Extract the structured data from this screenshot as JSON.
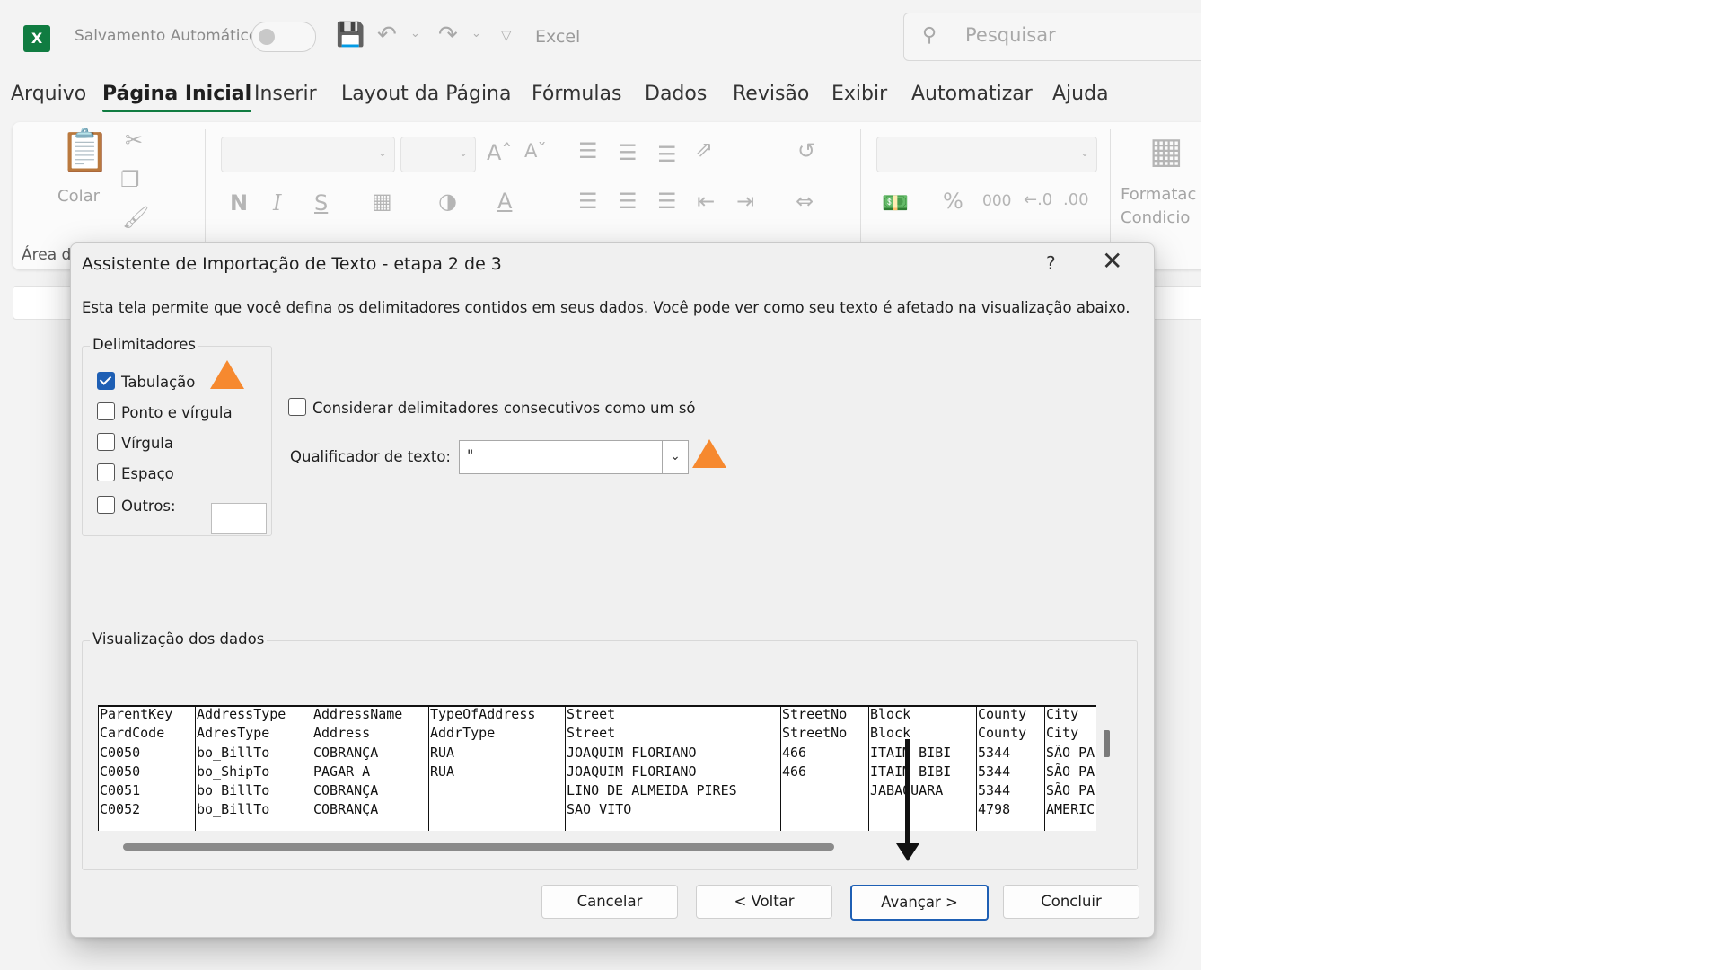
{
  "window": {
    "autosave_label": "Salvamento Automático",
    "app_title": "Excel",
    "search_placeholder": "Pesquisar",
    "logo_letter": "X"
  },
  "tabs": [
    "Arquivo",
    "Página Inicial",
    "Inserir",
    "Layout da Página",
    "Fórmulas",
    "Dados",
    "Revisão",
    "Exibir",
    "Automatizar",
    "Ajuda"
  ],
  "active_tab": "Página Inicial",
  "ribbon": {
    "paste_label": "Colar",
    "clipboard_group": "Área d",
    "cond_format_line1": "Formatac",
    "cond_format_line2": "Condicio",
    "bold": "N",
    "italic": "I",
    "underline": "S",
    "percent": "%",
    "thousands": "000"
  },
  "dialog": {
    "title": "Assistente de Importação de Texto - etapa 2 de 3",
    "help": "?",
    "description": "Esta tela permite que você defina os delimitadores contidos em seus dados. Você pode ver como seu texto é afetado na visualização abaixo.",
    "delimiters_legend": "Delimitadores",
    "delimiters": [
      {
        "label": "Tabulação",
        "checked": true
      },
      {
        "label": "Ponto e vírgula",
        "checked": false
      },
      {
        "label": "Vírgula",
        "checked": false
      },
      {
        "label": "Espaço",
        "checked": false
      },
      {
        "label": "Outros:",
        "checked": false
      }
    ],
    "consecutive_label": "Considerar delimitadores consecutivos como um só",
    "consecutive_checked": false,
    "qualifier_label": "Qualificador de texto:",
    "qualifier_value": "\"",
    "preview_legend": "Visualização dos dados",
    "preview": {
      "columns": [
        [
          "ParentKey",
          "CardCode",
          "C0050",
          "C0050",
          "C0051",
          "C0052"
        ],
        [
          "AddressType",
          "AdresType",
          "bo_BillTo",
          "bo_ShipTo",
          "bo_BillTo",
          "bo_BillTo"
        ],
        [
          "AddressName",
          "Address",
          "COBRANÇA",
          "PAGAR A",
          "COBRANÇA",
          "COBRANÇA"
        ],
        [
          "TypeOfAddress",
          "AddrType",
          "RUA",
          "RUA",
          "",
          ""
        ],
        [
          "Street",
          "Street",
          "JOAQUIM FLORIANO",
          "JOAQUIM FLORIANO",
          "LINO DE ALMEIDA PIRES",
          "SAO VITO"
        ],
        [
          "StreetNo",
          "StreetNo",
          "466",
          "466",
          "",
          ""
        ],
        [
          "Block",
          "Block",
          "ITAIM BIBI",
          "ITAIM BIBI",
          "JABAQUARA",
          ""
        ],
        [
          "County",
          "County",
          "5344",
          "5344",
          "5344",
          "4798"
        ],
        [
          "City",
          "City",
          "SÃO PA",
          "SÃO PA",
          "SÃO PA",
          "AMERIC"
        ]
      ]
    },
    "buttons": {
      "cancel": "Cancelar",
      "back": "< Voltar",
      "next": "Avançar >",
      "finish": "Concluir"
    }
  },
  "colors": {
    "excel_green": "#107c41",
    "annotation_orange": "#f6892f",
    "checkbox_blue": "#1e5fb4"
  }
}
